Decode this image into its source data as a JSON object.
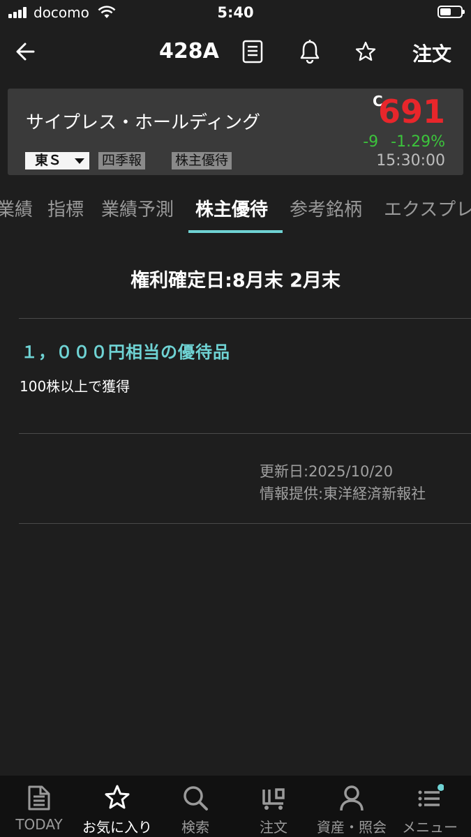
{
  "status_bar": {
    "carrier": "docomo",
    "time": "5:40"
  },
  "nav": {
    "stock_code": "428A",
    "order_label": "注文",
    "icons": [
      "back-arrow-icon",
      "document-icon",
      "bell-icon",
      "star-icon"
    ]
  },
  "stock": {
    "name": "サイプレス・ホールディング",
    "price_label": "C",
    "price": "691",
    "change": "-9",
    "change_pct": "-1.29%",
    "time": "15:30:00",
    "market": "東Ｓ",
    "badges": [
      "四季報",
      "株主優待"
    ],
    "colors": {
      "price": "#e8262b",
      "change": "#3cc43c",
      "accent": "#6fd3d4"
    }
  },
  "tabs": [
    "業績",
    "指標",
    "業績予測",
    "株主優待",
    "参考銘柄",
    "エクスプレ"
  ],
  "active_tab": "株主優待",
  "benefit": {
    "record_date": "権利確定日:8月末 2月末",
    "title": "１，０００円相当の優待品",
    "condition": "100株以上で獲得",
    "updated": "更新日:2025/10/20",
    "source": "情報提供:東洋経済新報社"
  },
  "bottom_tabs": [
    {
      "label": "TODAY",
      "icon": "today-icon"
    },
    {
      "label": "お気に入り",
      "icon": "star-icon"
    },
    {
      "label": "検索",
      "icon": "search-icon"
    },
    {
      "label": "注文",
      "icon": "cart-icon"
    },
    {
      "label": "資産・照会",
      "icon": "person-icon"
    },
    {
      "label": "メニュー",
      "icon": "menu-icon"
    }
  ],
  "active_bottom_tab": "お気に入り"
}
